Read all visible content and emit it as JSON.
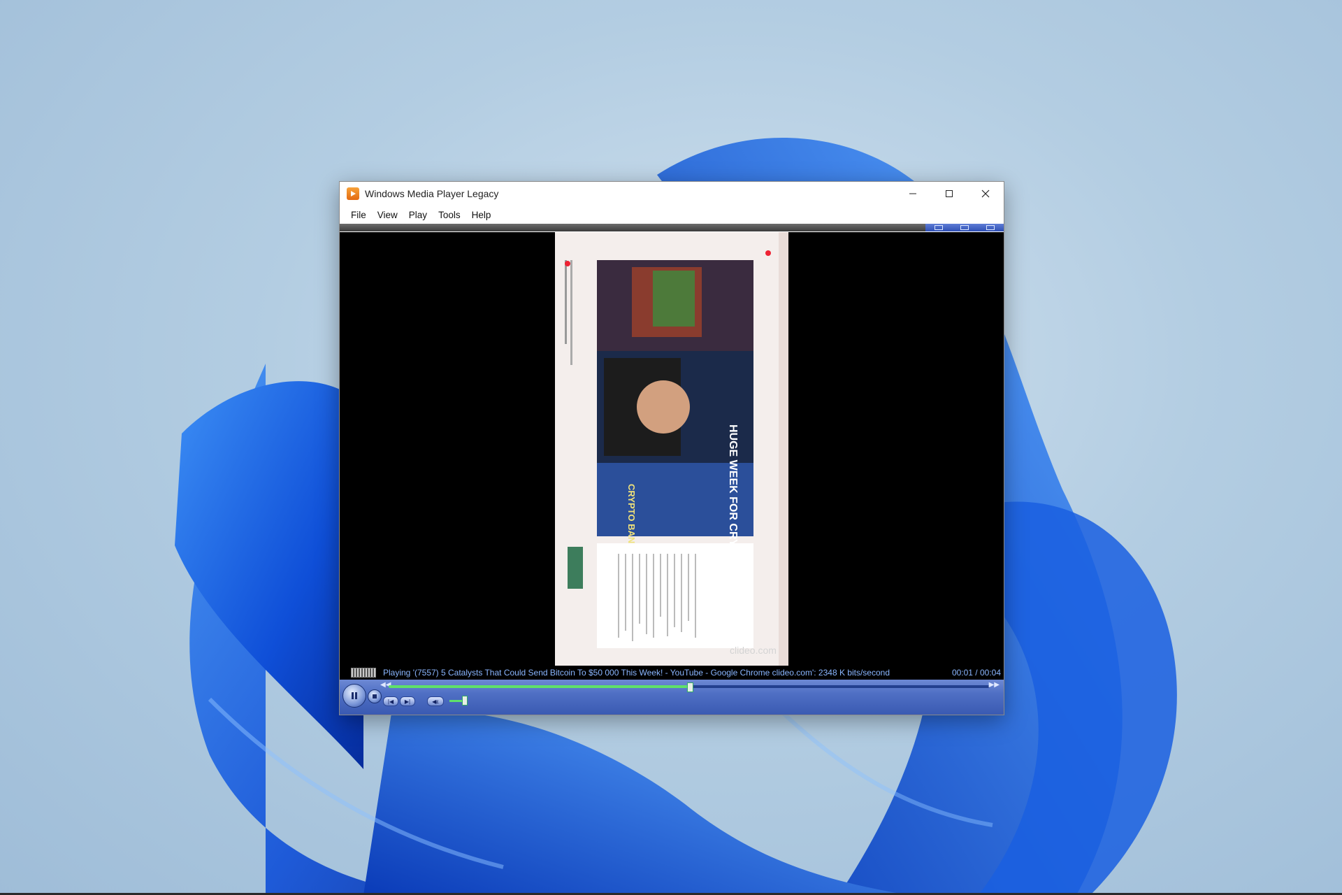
{
  "window": {
    "title": "Windows Media Player Legacy",
    "menu": [
      "File",
      "View",
      "Play",
      "Tools",
      "Help"
    ]
  },
  "status": {
    "text": "Playing '(7557) 5 Catalysts That Could Send Bitcoin To $50 000 This Week! - YouTube - Google Chrome clideo.com': 2348 K bits/second",
    "time": "00:01 / 00:04"
  },
  "video": {
    "thumbnail_text_1": "HUGE WEEK FOR CRYPTO!",
    "thumbnail_text_2": "CRYPTO BANTER",
    "watermark": "clideo.com"
  },
  "playback": {
    "progress": 0.5,
    "volume": 0.35
  },
  "colors": {
    "accent": "#3a5ab2",
    "seek_fill": "#5fe06a",
    "status_text": "#8ab6ff"
  },
  "icons": {
    "app": "media-player-icon",
    "minimize": "minimize-icon",
    "maximize": "maximize-icon",
    "close": "close-icon",
    "pause": "pause-icon",
    "stop": "stop-icon",
    "previous": "previous-icon",
    "next": "next-icon",
    "mute": "speaker-icon",
    "rewind": "rewind-icon",
    "fast_forward": "fast-forward-icon"
  }
}
